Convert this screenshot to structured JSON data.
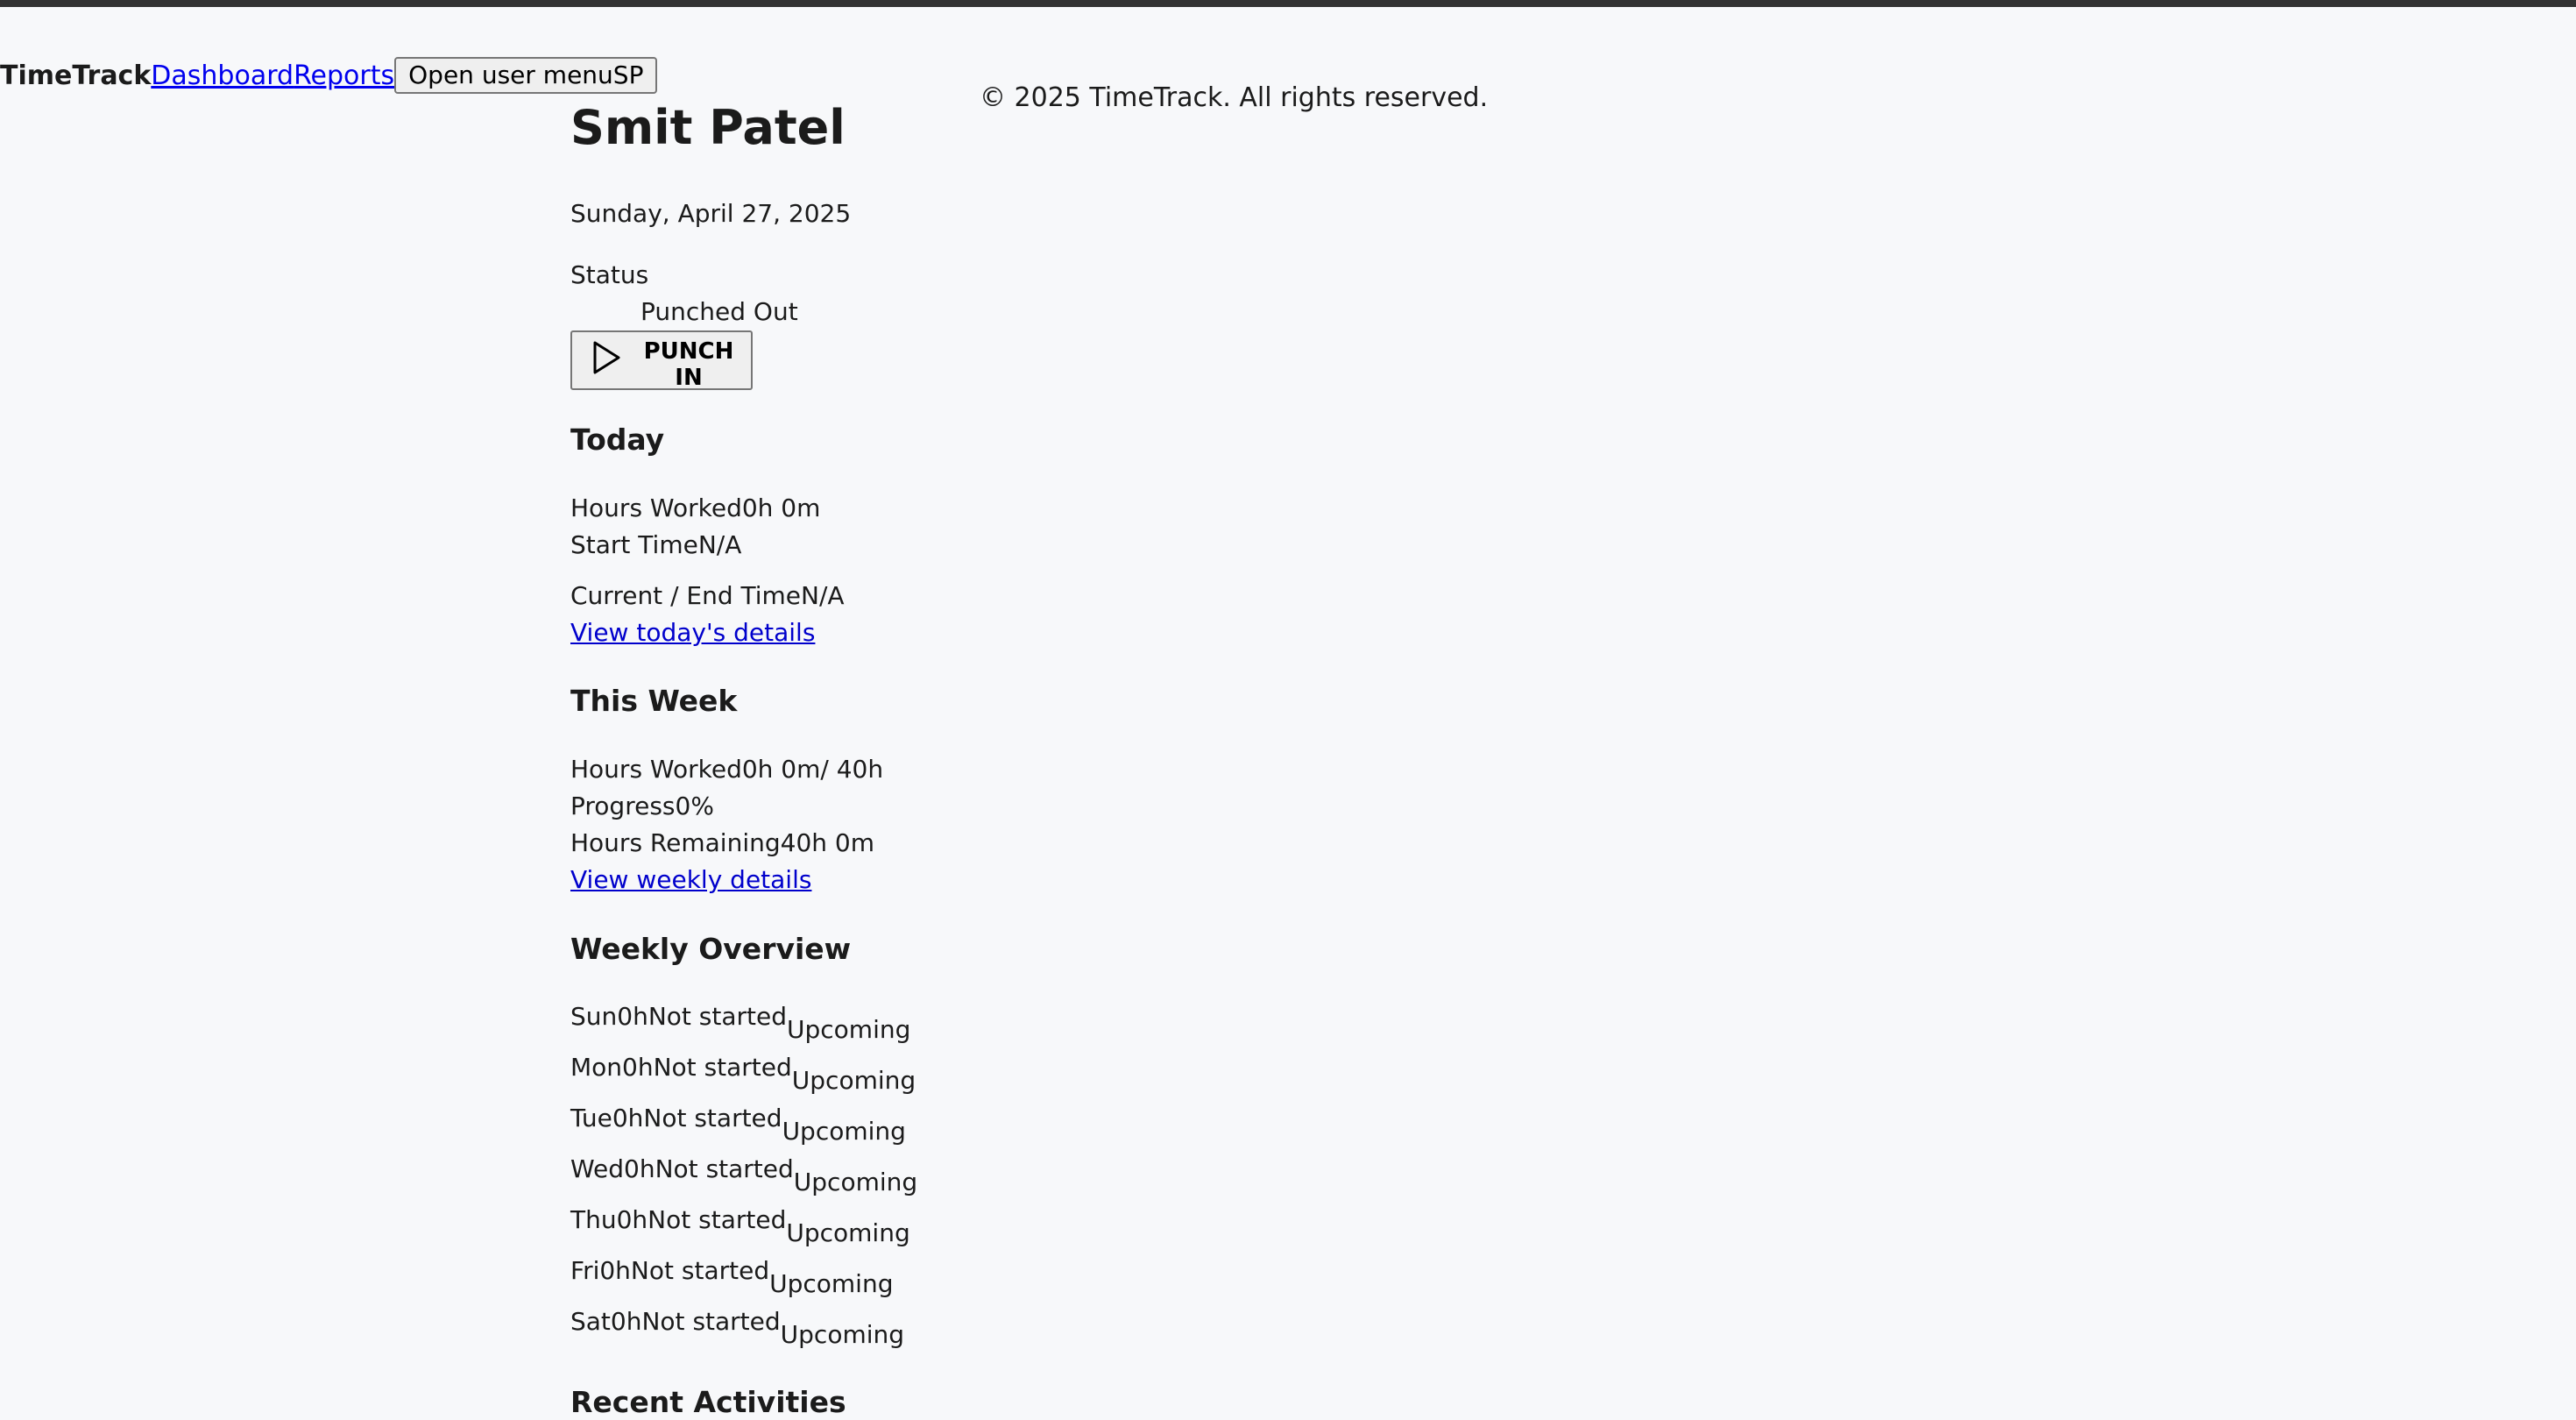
{
  "nav": {
    "brand": "TimeTrack",
    "links": [
      "Dashboard",
      "Reports"
    ],
    "user_menu_label": "Open user menu",
    "user_initials": "SP"
  },
  "footer": {
    "copyright": "© 2025 TimeTrack. All rights reserved."
  },
  "profile": {
    "name": "Smit Patel",
    "date": "Sunday, April 27, 2025"
  },
  "status": {
    "label": "Status",
    "value": "Punched Out",
    "button_label": "PUNCH IN"
  },
  "today": {
    "heading": "Today",
    "hours_worked_label": "Hours Worked",
    "hours_worked": "0h 0m",
    "start_time_label": "Start Time",
    "start_time": "N/A",
    "end_time_label": "Current / End Time",
    "end_time": "N/A",
    "details_link": "View today's details"
  },
  "week": {
    "heading": "This Week",
    "hours_worked_label": "Hours Worked",
    "hours_worked": "0h 0m",
    "hours_target": "/ 40h",
    "progress_label": "Progress",
    "progress": "0%",
    "remaining_label": "Hours Remaining",
    "remaining": "40h 0m",
    "details_link": "View weekly details"
  },
  "overview": {
    "heading": "Weekly Overview",
    "days": [
      {
        "day": "Sun",
        "hours": "0h",
        "state": "Not started",
        "tag": "Upcoming"
      },
      {
        "day": "Mon",
        "hours": "0h",
        "state": "Not started",
        "tag": "Upcoming"
      },
      {
        "day": "Tue",
        "hours": "0h",
        "state": "Not started",
        "tag": "Upcoming"
      },
      {
        "day": "Wed",
        "hours": "0h",
        "state": "Not started",
        "tag": "Upcoming"
      },
      {
        "day": "Thu",
        "hours": "0h",
        "state": "Not started",
        "tag": "Upcoming"
      },
      {
        "day": "Fri",
        "hours": "0h",
        "state": "Not started",
        "tag": "Upcoming"
      },
      {
        "day": "Sat",
        "hours": "0h",
        "state": "Not started",
        "tag": "Upcoming"
      }
    ]
  },
  "recent": {
    "heading": "Recent Activities"
  },
  "icons": {
    "punch_icon": "play-icon"
  }
}
